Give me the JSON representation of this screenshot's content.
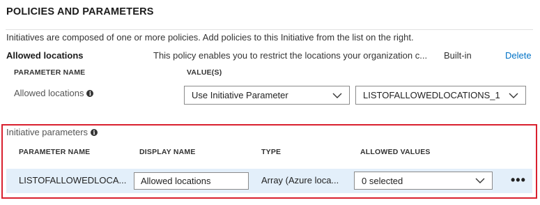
{
  "section": {
    "title": "POLICIES AND PARAMETERS",
    "intro": "Initiatives are composed of one or more policies. Add policies to this Initiative from the list on the right."
  },
  "policy": {
    "name": "Allowed locations",
    "description": "This policy enables you to restrict the locations your organization c...",
    "type": "Built-in",
    "delete_label": "Delete",
    "headers": {
      "parameter_name": "PARAMETER NAME",
      "values": "VALUE(S)"
    },
    "parameter_label": "Allowed locations",
    "value_mode": "Use Initiative Parameter",
    "value_param": "LISTOFALLOWEDLOCATIONS_1"
  },
  "initiative_params": {
    "title": "Initiative parameters",
    "headers": {
      "parameter_name": "PARAMETER NAME",
      "display_name": "DISPLAY NAME",
      "type": "TYPE",
      "allowed_values": "ALLOWED VALUES"
    },
    "row": {
      "parameter_name": "LISTOFALLOWEDLOCA...",
      "display_name": "Allowed locations",
      "type": "Array (Azure loca...",
      "allowed_values": "0 selected",
      "more_label": "•••"
    }
  },
  "colors": {
    "accent": "#0072c6",
    "highlight_border": "#d9202e",
    "row_selected": "#e3effa"
  },
  "icons": [
    "info-icon",
    "chevron-down-icon",
    "more-icon"
  ]
}
